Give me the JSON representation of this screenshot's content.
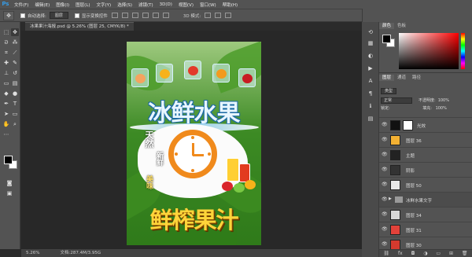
{
  "app": {
    "logo": "Ps"
  },
  "menu": [
    "文件(F)",
    "编辑(E)",
    "图像(I)",
    "图层(L)",
    "文字(Y)",
    "选择(S)",
    "滤镜(T)",
    "3D(D)",
    "视图(V)",
    "窗口(W)",
    "帮助(H)"
  ],
  "options": {
    "tool_icon": "move-tool-icon",
    "checkbox_label": "自动选择:",
    "select_value": "图层",
    "show_transform": "显示变换控件",
    "mode_3d": "3D 模式:",
    "workspace": "基本"
  },
  "document": {
    "tab_title": "冰果果汁海报.psd @ 5.26% (图层 25, CMYK/8) *",
    "zoom": "5.26%",
    "doc_info": "文档:287.4M/3.95G"
  },
  "poster": {
    "title_top": "冰鲜水果",
    "title_bottom": "鲜榨果汁",
    "side_left_1": "天然",
    "side_left_2": "新鲜",
    "side_right": "美味"
  },
  "panels": {
    "color_tabs": [
      "颜色",
      "色板"
    ],
    "layer_tabs": [
      "图层",
      "通道",
      "路径"
    ],
    "filter_label": "类型",
    "blend_mode": "正常",
    "opacity_label": "不透明度:",
    "opacity_value": "100%",
    "lock_label": "锁定:",
    "fill_label": "填充:",
    "fill_value": "100%"
  },
  "layers": [
    {
      "name": "光效",
      "mask": true
    },
    {
      "name": "图层 36",
      "mask": false
    },
    {
      "name": "主题",
      "mask": false
    },
    {
      "name": "阴影",
      "mask": false
    },
    {
      "name": "图层 50",
      "mask": false
    },
    {
      "name": "冰鲜水果文字",
      "mask": false,
      "group": true
    },
    {
      "name": "图层 34",
      "mask": false
    },
    {
      "name": "图层 31",
      "mask": false
    },
    {
      "name": "图层 30",
      "mask": false
    }
  ],
  "colors": {
    "foreground": "#000000",
    "background": "#ffffff",
    "accent_orange": "#f08a1c"
  }
}
